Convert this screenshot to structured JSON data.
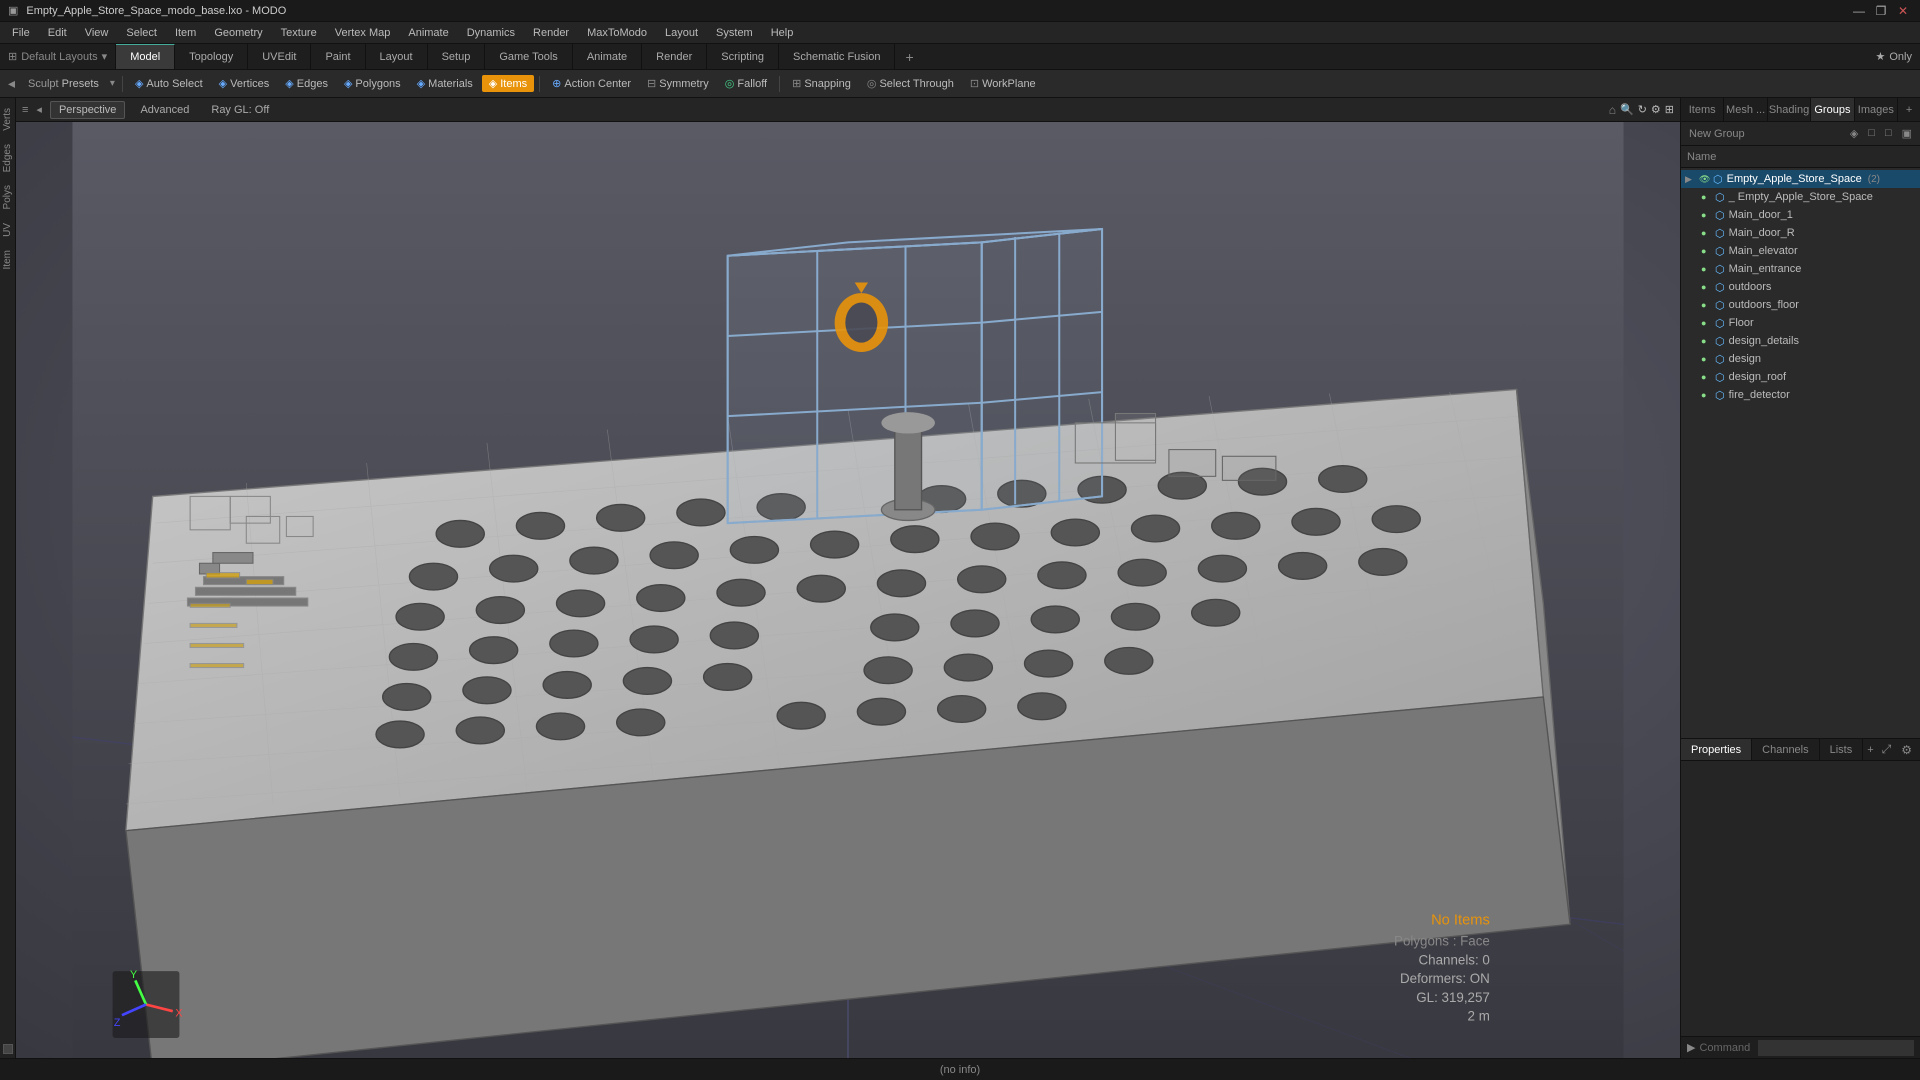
{
  "titlebar": {
    "title": "Empty_Apple_Store_Space_modo_base.lxo - MODO",
    "controls": [
      "—",
      "❐",
      "✕"
    ]
  },
  "menubar": {
    "items": [
      "File",
      "Edit",
      "View",
      "Select",
      "Item",
      "Geometry",
      "Texture",
      "Vertex Map",
      "Animate",
      "Dynamics",
      "Render",
      "MaxToModo",
      "Layout",
      "System",
      "Help"
    ]
  },
  "tabbar": {
    "tabs": [
      "Model",
      "Topology",
      "UVEdit",
      "Paint",
      "Layout",
      "Setup",
      "Game Tools",
      "Animate",
      "Render",
      "Scripting",
      "Schematic Fusion"
    ],
    "active": "Model",
    "right_label": "Only"
  },
  "toolbar": {
    "sculpt": "Sculpt",
    "presets": "Presets",
    "auto_select": "Auto Select",
    "vertices": "Vertices",
    "edges": "Edges",
    "polygons": "Polygons",
    "materials": "Materials",
    "items": "Items",
    "action_center": "Action Center",
    "symmetry": "Symmetry",
    "falloff": "Falloff",
    "snapping": "Snapping",
    "select_through": "Select Through",
    "workplane": "WorkPlane"
  },
  "viewport": {
    "view_type": "Perspective",
    "shading": "Advanced",
    "render": "Ray GL: Off"
  },
  "scene": {
    "no_items": "No Items",
    "stats": {
      "polygons": "Polygons : Face",
      "channels": "Channels: 0",
      "deformers": "Deformers: ON",
      "gl": "GL: 319,257",
      "distance": "2 m"
    }
  },
  "right_panel": {
    "tabs": [
      "Items",
      "Mesh ...",
      "Shading",
      "Groups",
      "Images"
    ],
    "active_tab": "Groups",
    "new_group": "New Group",
    "name_col": "Name",
    "items": [
      {
        "label": "Empty_Apple_Store_Space",
        "indent": 0,
        "badge": "2",
        "selected": true,
        "has_child": true
      },
      {
        "label": "Empty_Apple_Store_Space",
        "indent": 1,
        "selected": false
      },
      {
        "label": "Main_door_1",
        "indent": 1,
        "selected": false
      },
      {
        "label": "Main_door_R",
        "indent": 1,
        "selected": false
      },
      {
        "label": "Main_elevator",
        "indent": 1,
        "selected": false
      },
      {
        "label": "Main_entrance",
        "indent": 1,
        "selected": false
      },
      {
        "label": "outdoors",
        "indent": 1,
        "selected": false
      },
      {
        "label": "outdoors_floor",
        "indent": 1,
        "selected": false
      },
      {
        "label": "Floor",
        "indent": 1,
        "selected": false
      },
      {
        "label": "design_details",
        "indent": 1,
        "selected": false
      },
      {
        "label": "design",
        "indent": 1,
        "selected": false
      },
      {
        "label": "design_roof",
        "indent": 1,
        "selected": false
      },
      {
        "label": "fire_detector",
        "indent": 1,
        "selected": false
      }
    ]
  },
  "right_bottom": {
    "tabs": [
      "Properties",
      "Channels",
      "Lists"
    ],
    "active_tab": "Properties"
  },
  "statusbar": {
    "message": "(no info)"
  },
  "cmdbar": {
    "label": "Command",
    "placeholder": ""
  }
}
